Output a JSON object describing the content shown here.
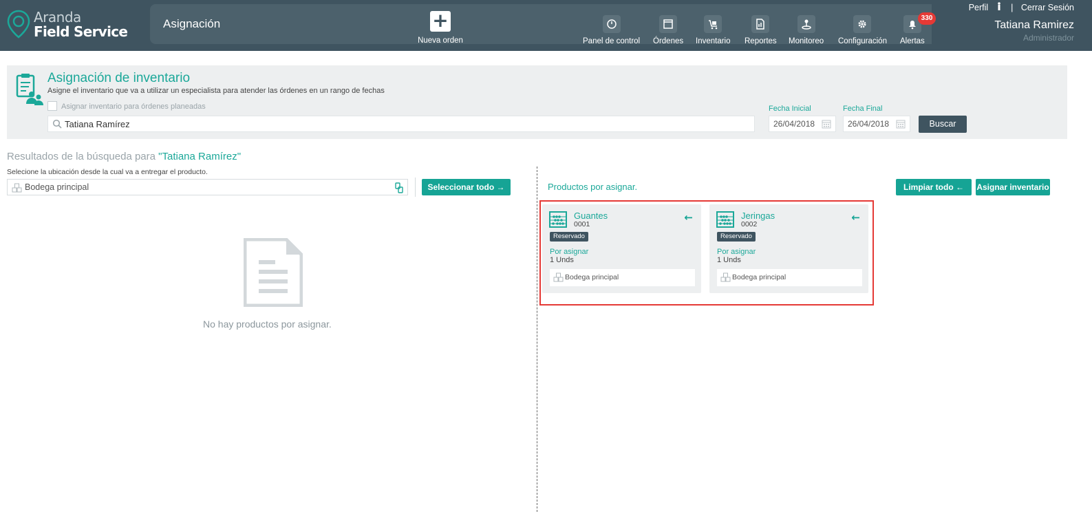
{
  "brand": {
    "line1": "Aranda",
    "line2": "Field Service"
  },
  "header": {
    "section_title": "Asignación",
    "new_order_label": "Nueva orden",
    "nav": [
      {
        "label": "Panel de control",
        "icon": "dashboard-icon"
      },
      {
        "label": "Órdenes",
        "icon": "orders-icon"
      },
      {
        "label": "Inventario",
        "icon": "inventory-icon"
      },
      {
        "label": "Reportes",
        "icon": "reports-icon"
      },
      {
        "label": "Monitoreo",
        "icon": "monitoring-icon"
      },
      {
        "label": "Configuración",
        "icon": "gear-icon"
      },
      {
        "label": "Alertas",
        "icon": "bell-icon",
        "badge": "330"
      }
    ]
  },
  "user": {
    "profile_link": "Perfil",
    "separator": "|",
    "logout_link": "Cerrar Sesión",
    "name": "Tatiana Ramirez",
    "role": "Administrador"
  },
  "filter": {
    "title": "Asignación de inventario",
    "description": "Asigne el inventario que va a utilizar un especialista para atender las órdenes en un rango de fechas",
    "checkbox_label": "Asignar inventario para órdenes planeadas",
    "search_value": "Tatiana Ramírez",
    "start_date_label": "Fecha Inicial",
    "start_date_value": "26/04/2018",
    "end_date_label": "Fecha Final",
    "end_date_value": "26/04/2018",
    "search_button": "Buscar"
  },
  "results": {
    "title_prefix": "Resultados de la búsqueda para ",
    "title_query": "\"Tatiana Ramírez\"",
    "hint": "Selecione la ubicación desde la cual va a entregar el producto.",
    "location_value": "Bodega principal",
    "select_all_button": "Seleccionar todo →",
    "empty_message": "No hay productos por asignar."
  },
  "products": {
    "title": "Productos por asignar.",
    "clear_all_button": "Limpiar todo ←",
    "assign_button": "Asignar inventario",
    "items": [
      {
        "name": "Guantes",
        "code": "0001",
        "status": "Reservado",
        "pending_label": "Por asignar",
        "qty": "1 Unds",
        "location": "Bodega principal"
      },
      {
        "name": "Jeringas",
        "code": "0002",
        "status": "Reservado",
        "pending_label": "Por asignar",
        "qty": "1 Unds",
        "location": "Bodega principal"
      }
    ]
  },
  "colors": {
    "header_bg": "#3f5460",
    "accent": "#16a495",
    "badge": "#e53935",
    "highlight_border": "#e53935"
  }
}
